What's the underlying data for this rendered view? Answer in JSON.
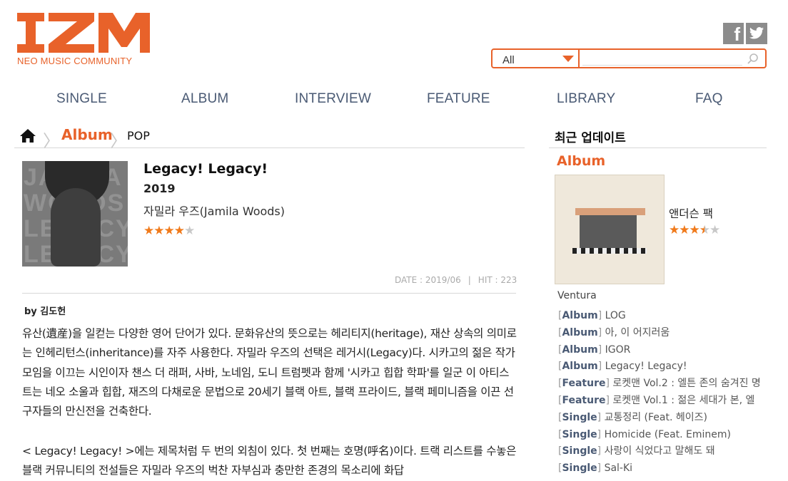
{
  "header": {
    "logo_text": "IZM",
    "logo_subtitle": "NEO MUSIC COMMUNITY",
    "social": [
      {
        "name": "facebook",
        "icon": "facebook-icon",
        "glyph": "f"
      },
      {
        "name": "twitter",
        "icon": "twitter-icon"
      }
    ],
    "search": {
      "category_value": "All",
      "query": "",
      "icon": "search-icon"
    }
  },
  "nav": {
    "items": [
      "SINGLE",
      "ALBUM",
      "INTERVIEW",
      "FEATURE",
      "LIBRARY",
      "FAQ"
    ]
  },
  "breadcrumb": {
    "home_icon": "home-icon",
    "section": "Album",
    "genre": "POP"
  },
  "album": {
    "title": "Legacy! Legacy!",
    "year": "2019",
    "artist": "자밀라 우즈(Jamila Woods)",
    "rating": {
      "value": 4,
      "max": 5
    },
    "date": "DATE : 2019/06",
    "separator": "|",
    "hits": "HIT : 223",
    "cover_text": [
      "JAMILA",
      "WOODS",
      "LEGACY",
      "LEGACY"
    ]
  },
  "review": {
    "author": "by 김도헌",
    "paragraphs": [
      "유산(遺産)을 일컫는 다양한 영어 단어가 있다. 문화유산의 뜻으로는 헤리티지(heritage), 재산 상속의 의미로는 인헤리턴스(inheritance)를 자주 사용한다. 자밀라 우즈의 선택은 레거시(Legacy)다. 시카고의 젊은 작가 모임을 이끄는 시인이자 챈스 더 래퍼, 사바, 노네임, 도니 트럼펫과 함께 '시카고 힙합 학파'를 일군 이 아티스트는 네오 소울과 힙합, 재즈의 다채로운 문법으로 20세기 블랙 아트, 블랙 프라이드, 블랙 페미니즘을 이끈 선구자들의 만신전을 건축한다.",
      "< Legacy! Legacy! >에는 제목처럼 두 번의 외침이 있다. 첫 번째는 호명(呼名)이다. 트랙 리스트를 수놓은 블랙 커뮤니티의 전설들은 자밀라 우즈의 벅찬 자부심과 충만한 존경의 목소리에 화답"
    ]
  },
  "sidebar": {
    "title": "최근 업데이트",
    "category": "Album",
    "featured": {
      "name": "앤더슨 팩",
      "rating": {
        "value": 3.5,
        "max": 5
      },
      "subtitle": "Ventura"
    },
    "items": [
      {
        "tag": "Album",
        "text": "LOG"
      },
      {
        "tag": "Album",
        "text": "아, 이 어지러움"
      },
      {
        "tag": "Album",
        "text": "IGOR"
      },
      {
        "tag": "Album",
        "text": "Legacy! Legacy!"
      },
      {
        "tag": "Feature",
        "text": "로켓맨 Vol.2 : 엘튼 존의 숨겨진 명"
      },
      {
        "tag": "Feature",
        "text": "로켓맨 Vol.1 : 젊은 세대가 본, 엘"
      },
      {
        "tag": "Single",
        "text": "교통정리 (Feat. 헤이즈)"
      },
      {
        "tag": "Single",
        "text": "Homicide (Feat. Eminem)"
      },
      {
        "tag": "Single",
        "text": "사랑이 식었다고 말해도 돼"
      },
      {
        "tag": "Single",
        "text": "Sal-Ki"
      }
    ]
  },
  "colors": {
    "accent": "#e8622a",
    "nav_text": "#4a5a74",
    "star_on": "#f07a1b",
    "star_off": "#c8c8c8"
  }
}
